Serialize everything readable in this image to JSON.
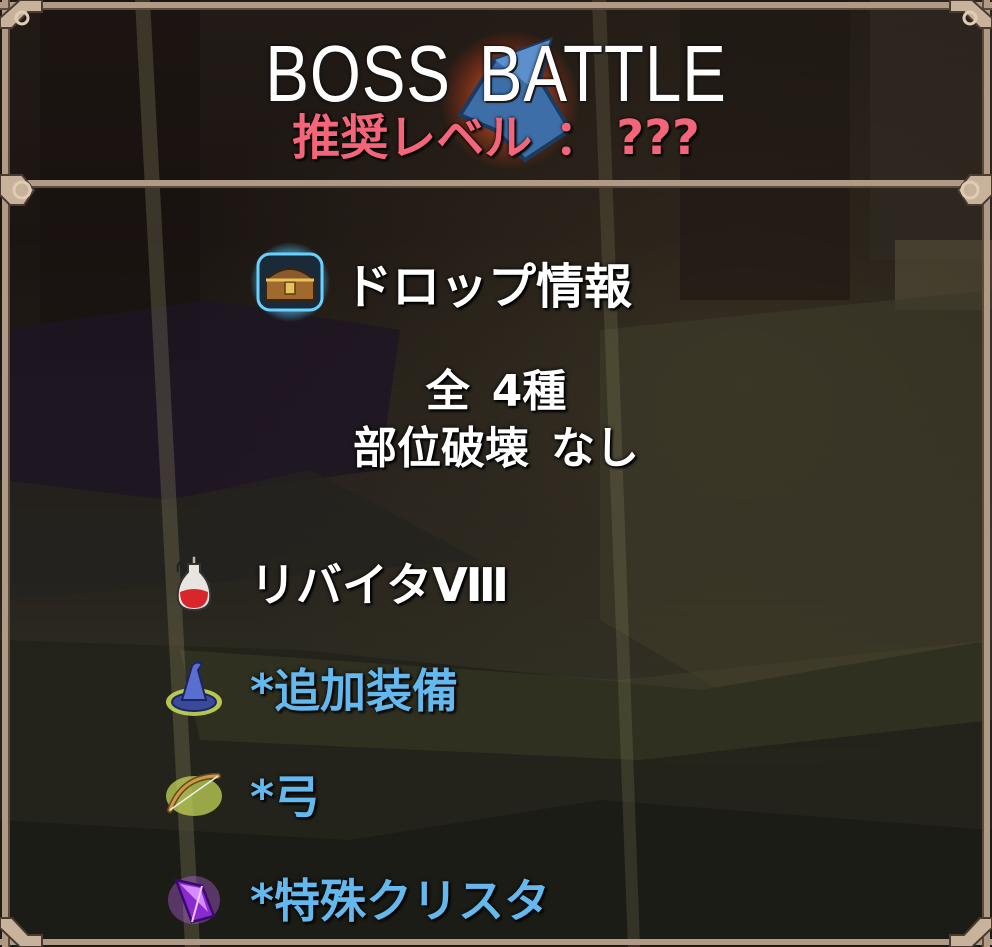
{
  "header": {
    "title_word1": "BOSS",
    "title_word2": "BATTLE",
    "recommended_label": "推奨レベル",
    "recommended_sep": "：",
    "recommended_value": "???"
  },
  "drop_info": {
    "title": "ドロップ情報",
    "icon": "treasure-chest-icon",
    "count_prefix": "全",
    "count_value": "4種",
    "part_break_label": "部位破壊",
    "part_break_value": "なし"
  },
  "items": [
    {
      "label": "リバイタⅧ",
      "icon": "potion-icon",
      "color": "#ffffff"
    },
    {
      "label": "*追加装備",
      "icon": "wizard-hat-icon",
      "color": "#63b8ee"
    },
    {
      "label": "*弓",
      "icon": "bow-icon",
      "color": "#63b8ee"
    },
    {
      "label": "*特殊クリスタ",
      "icon": "crystal-icon",
      "color": "#63b8ee"
    }
  ],
  "colors": {
    "level_text": "#f4657a",
    "item_blue": "#63b8ee",
    "frame": "#a08a78"
  }
}
